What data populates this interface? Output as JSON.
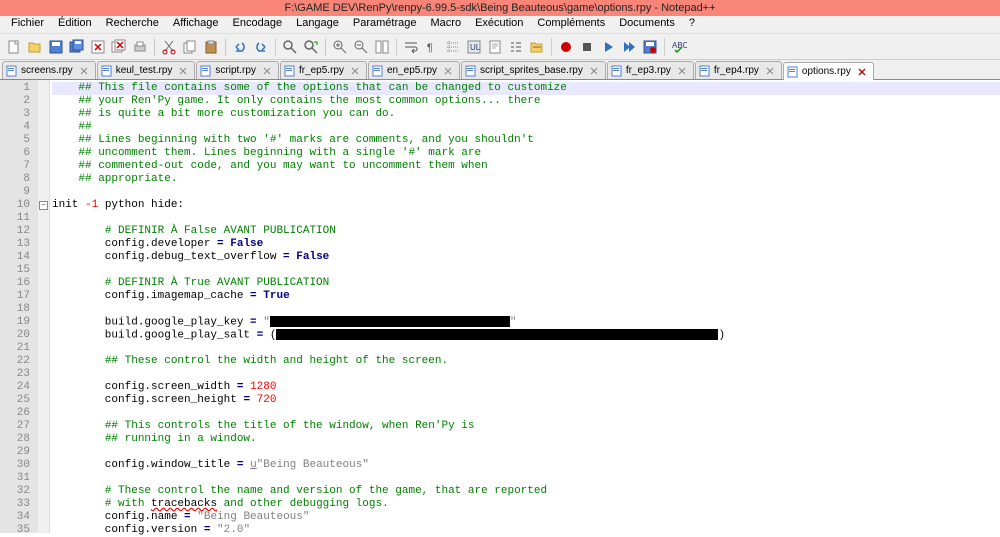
{
  "window": {
    "title": "F:\\GAME DEV\\RenPy\\renpy-6.99.5-sdk\\Being Beauteous\\game\\options.rpy - Notepad++"
  },
  "menu": {
    "items": [
      "Fichier",
      "Édition",
      "Recherche",
      "Affichage",
      "Encodage",
      "Langage",
      "Paramétrage",
      "Macro",
      "Exécution",
      "Compléments",
      "Documents",
      "?"
    ]
  },
  "tabs": [
    {
      "label": "screens.rpy",
      "active": false
    },
    {
      "label": "keul_test.rpy",
      "active": false
    },
    {
      "label": "script.rpy",
      "active": false
    },
    {
      "label": "fr_ep5.rpy",
      "active": false
    },
    {
      "label": "en_ep5.rpy",
      "active": false
    },
    {
      "label": "script_sprites_base.rpy",
      "active": false
    },
    {
      "label": "fr_ep3.rpy",
      "active": false
    },
    {
      "label": "fr_ep4.rpy",
      "active": false
    },
    {
      "label": "options.rpy",
      "active": true
    }
  ],
  "code": {
    "lines": [
      {
        "n": 1,
        "tokens": [
          [
            "    ",
            null
          ],
          [
            "## This file contains some of the options that can be changed to customize",
            "c-comment"
          ]
        ],
        "hl": true
      },
      {
        "n": 2,
        "tokens": [
          [
            "    ",
            null
          ],
          [
            "## your Ren'Py game. It only contains the most common options... there",
            "c-comment"
          ]
        ]
      },
      {
        "n": 3,
        "tokens": [
          [
            "    ",
            null
          ],
          [
            "## is quite a bit more customization you can do.",
            "c-comment"
          ]
        ]
      },
      {
        "n": 4,
        "tokens": [
          [
            "    ",
            null
          ],
          [
            "##",
            "c-comment"
          ]
        ]
      },
      {
        "n": 5,
        "tokens": [
          [
            "    ",
            null
          ],
          [
            "## Lines beginning with two '#' marks are comments, and you shouldn't",
            "c-comment"
          ]
        ]
      },
      {
        "n": 6,
        "tokens": [
          [
            "    ",
            null
          ],
          [
            "## uncomment them. Lines beginning with a single '#' mark are",
            "c-comment"
          ]
        ]
      },
      {
        "n": 7,
        "tokens": [
          [
            "    ",
            null
          ],
          [
            "## commented-out code, and you may want to uncomment them when",
            "c-comment"
          ]
        ]
      },
      {
        "n": 8,
        "tokens": [
          [
            "    ",
            null
          ],
          [
            "## appropriate.",
            "c-comment"
          ]
        ]
      },
      {
        "n": 9,
        "tokens": [
          [
            "",
            null
          ]
        ]
      },
      {
        "n": 10,
        "fold": "-",
        "tokens": [
          [
            "init ",
            "c-id"
          ],
          [
            "-1",
            "c-num"
          ],
          [
            " python hide:",
            "c-id"
          ]
        ]
      },
      {
        "n": 11,
        "tokens": [
          [
            "",
            null
          ]
        ]
      },
      {
        "n": 12,
        "tokens": [
          [
            "        ",
            null
          ],
          [
            "# DEFINIR À False AVANT PUBLICATION",
            "c-comment"
          ]
        ]
      },
      {
        "n": 13,
        "tokens": [
          [
            "        config.developer ",
            "c-id"
          ],
          [
            "=",
            "c-eq"
          ],
          [
            " ",
            null
          ],
          [
            "False",
            "c-bool"
          ]
        ]
      },
      {
        "n": 14,
        "tokens": [
          [
            "        config.debug_text_overflow ",
            "c-id"
          ],
          [
            "=",
            "c-eq"
          ],
          [
            " ",
            null
          ],
          [
            "False",
            "c-bool"
          ]
        ]
      },
      {
        "n": 15,
        "tokens": [
          [
            "",
            null
          ]
        ]
      },
      {
        "n": 16,
        "tokens": [
          [
            "        ",
            null
          ],
          [
            "# DEFINIR À True AVANT PUBLICATION",
            "c-comment"
          ]
        ]
      },
      {
        "n": 17,
        "tokens": [
          [
            "        config.imagemap_cache ",
            "c-id"
          ],
          [
            "=",
            "c-eq"
          ],
          [
            " ",
            null
          ],
          [
            "True",
            "c-bool"
          ]
        ]
      },
      {
        "n": 18,
        "tokens": [
          [
            "",
            null
          ]
        ]
      },
      {
        "n": 19,
        "tokens": [
          [
            "        build.google_play_key ",
            "c-id"
          ],
          [
            "=",
            "c-eq"
          ],
          [
            " ",
            null
          ],
          [
            "\"",
            "c-str"
          ],
          [
            "__REDACT_240__",
            null
          ],
          [
            "\"",
            "c-str"
          ]
        ]
      },
      {
        "n": 20,
        "tokens": [
          [
            "        build.google_play_salt ",
            "c-id"
          ],
          [
            "=",
            "c-eq"
          ],
          [
            " (",
            null
          ],
          [
            "__REDACT_442__",
            null
          ],
          [
            ")",
            null
          ]
        ]
      },
      {
        "n": 21,
        "tokens": [
          [
            "",
            null
          ]
        ]
      },
      {
        "n": 22,
        "tokens": [
          [
            "        ",
            null
          ],
          [
            "## These control the width and height of the screen.",
            "c-comment"
          ]
        ]
      },
      {
        "n": 23,
        "tokens": [
          [
            "",
            null
          ]
        ]
      },
      {
        "n": 24,
        "tokens": [
          [
            "        config.screen_width ",
            "c-id"
          ],
          [
            "=",
            "c-eq"
          ],
          [
            " ",
            null
          ],
          [
            "1280",
            "c-num"
          ]
        ]
      },
      {
        "n": 25,
        "tokens": [
          [
            "        config.screen_height ",
            "c-id"
          ],
          [
            "=",
            "c-eq"
          ],
          [
            " ",
            null
          ],
          [
            "720",
            "c-num"
          ]
        ]
      },
      {
        "n": 26,
        "tokens": [
          [
            "",
            null
          ]
        ]
      },
      {
        "n": 27,
        "tokens": [
          [
            "        ",
            null
          ],
          [
            "## This controls the title of the window, when Ren'Py is",
            "c-comment"
          ]
        ]
      },
      {
        "n": 28,
        "tokens": [
          [
            "        ",
            null
          ],
          [
            "## running in a window.",
            "c-comment"
          ]
        ]
      },
      {
        "n": 29,
        "tokens": [
          [
            "",
            null
          ]
        ]
      },
      {
        "n": 30,
        "tokens": [
          [
            "        config.window_title ",
            "c-id"
          ],
          [
            "=",
            "c-eq"
          ],
          [
            " ",
            null
          ],
          [
            "u",
            "c-uprefix"
          ],
          [
            "\"Being Beauteous\"",
            "c-str"
          ]
        ]
      },
      {
        "n": 31,
        "tokens": [
          [
            "",
            null
          ]
        ]
      },
      {
        "n": 32,
        "tokens": [
          [
            "        ",
            null
          ],
          [
            "# These control the name and version of the game, that are reported",
            "c-comment"
          ]
        ]
      },
      {
        "n": 33,
        "tokens": [
          [
            "        ",
            null
          ],
          [
            "# with ",
            "c-comment"
          ],
          [
            "tracebacks",
            "c-err"
          ],
          [
            " and other debugging logs.",
            "c-comment"
          ]
        ]
      },
      {
        "n": 34,
        "tokens": [
          [
            "        config.name ",
            "c-id"
          ],
          [
            "=",
            "c-eq"
          ],
          [
            " ",
            null
          ],
          [
            "\"Being Beauteous\"",
            "c-str"
          ]
        ]
      },
      {
        "n": 35,
        "tokens": [
          [
            "        config.version ",
            "c-id"
          ],
          [
            "=",
            "c-eq"
          ],
          [
            " ",
            null
          ],
          [
            "\"2.0\"",
            "c-str"
          ]
        ]
      }
    ]
  }
}
